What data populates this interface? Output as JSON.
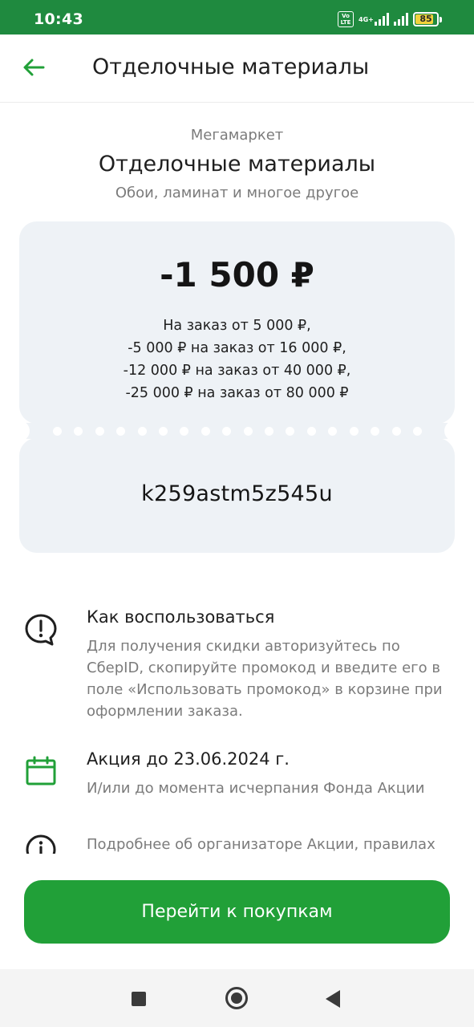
{
  "status_bar": {
    "time": "10:43",
    "volte": "Vo LTE",
    "network": "4G+",
    "battery_percent": "85",
    "battery_level": 0.85
  },
  "app_bar": {
    "back_icon": "arrow-left-icon",
    "title": "Отделочные материалы"
  },
  "header": {
    "store": "Мегамаркет",
    "title": "Отделочные материалы",
    "subtitle": "Обои, ламинат и многое другое"
  },
  "coupon": {
    "discount": "-1 500 ₽",
    "conditions": [
      "На заказ от 5 000 ₽,",
      "-5 000 ₽ на заказ от 16 000 ₽,",
      "-12 000 ₽ на заказ от 40 000 ₽,",
      "-25 000 ₽ на заказ от 80 000 ₽"
    ],
    "promo_code": "k259astm5z545u"
  },
  "info": {
    "how_to": {
      "icon": "speech-bubble-exclamation-icon",
      "title": "Как воспользоваться",
      "text": "Для получения скидки авторизуйтесь по СберID, скопируйте промокод и введите его в поле «Использовать промокод» в корзине при оформлении заказа."
    },
    "validity": {
      "icon": "calendar-icon",
      "title": "Акция до 23.06.2024 г.",
      "text": "И/или до момента исчерпания Фонда Акции"
    },
    "organizer": {
      "icon": "info-circle-icon",
      "text": "Подробнее об организаторе Акции, правилах"
    }
  },
  "cta": {
    "label": "Перейти к покупкам"
  },
  "colors": {
    "brand_green": "#21a038",
    "status_bar_green": "#1f8a3f",
    "card_background": "#eef2f6",
    "secondary_text": "#7b7b7b"
  }
}
